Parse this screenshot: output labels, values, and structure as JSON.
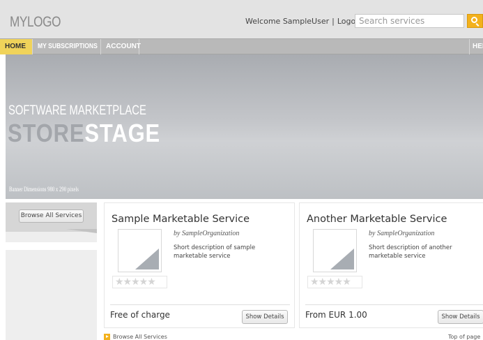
{
  "header": {
    "logo": "MYLOGO",
    "welcome_text": "Welcome SampleUser",
    "separator": "|",
    "logout_label": "Logout",
    "search_placeholder": "Search services",
    "search_icon": "magnifier-icon"
  },
  "nav": {
    "items": [
      {
        "label": "HOME",
        "active": true
      },
      {
        "label": "MY SUBSCRIPTIONS",
        "active": false
      },
      {
        "label": "ACCOUNT",
        "active": false
      }
    ],
    "help_label": "HELP"
  },
  "banner": {
    "line1": "SOFTWARE MARKETPLACE",
    "line2_part1": "STORE",
    "line2_part2": "STAGE",
    "note": "Banner Dimensions 980 x 290 pixels"
  },
  "sidebar": {
    "browse_label": "Browse All Services"
  },
  "services": [
    {
      "title": "Sample Marketable Service",
      "by": "by SampleOrganization",
      "description": "Short description of sample marketable service",
      "rating_stars": "★★★★★",
      "rating": 0,
      "price": "Free of charge",
      "details_label": "Show Details"
    },
    {
      "title": "Another Marketable Service",
      "by": "by SampleOrganization",
      "description": "Short description of another marketable service",
      "rating_stars": "★★★★★",
      "rating": 0,
      "price": "From EUR 1.00",
      "details_label": "Show Details"
    }
  ],
  "footer": {
    "browse_link": "Browse All Services",
    "top_link": "Top of page"
  },
  "colors": {
    "accent": "#f3b11c",
    "nav_active": "#f0d35a",
    "nav_bg": "#b9b9b9",
    "header_bg": "#e3e3e3"
  }
}
